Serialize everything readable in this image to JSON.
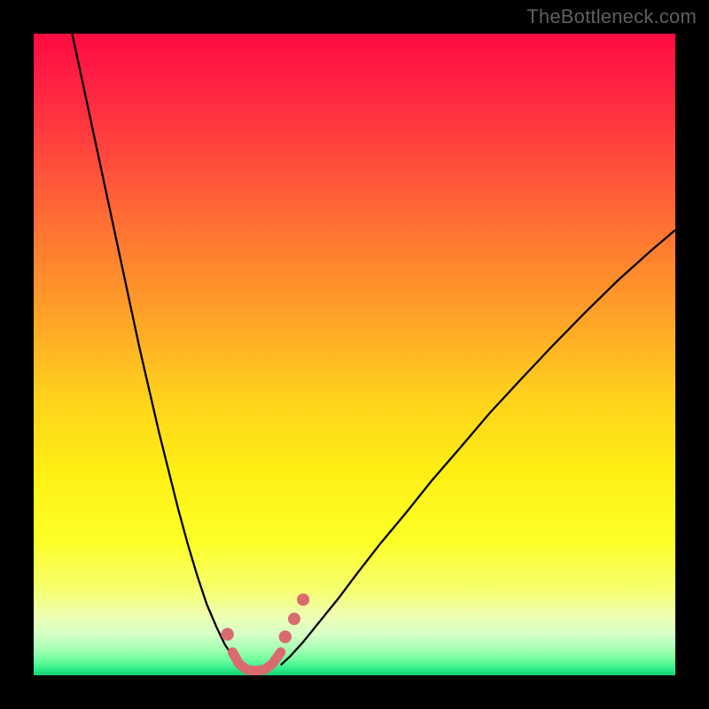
{
  "watermark": {
    "text": "TheBottleneck.com"
  },
  "chart_data": {
    "type": "line",
    "title": "",
    "xlabel": "",
    "ylabel": "",
    "xlim": [
      0,
      100
    ],
    "ylim": [
      0,
      100
    ],
    "grid": false,
    "legend": false,
    "background_gradient_stops": [
      {
        "offset": 0.0,
        "color": "#ff0b41"
      },
      {
        "offset": 0.07,
        "color": "#ff1f42"
      },
      {
        "offset": 0.15,
        "color": "#ff3a3f"
      },
      {
        "offset": 0.28,
        "color": "#ff6a35"
      },
      {
        "offset": 0.42,
        "color": "#ff9b29"
      },
      {
        "offset": 0.56,
        "color": "#ffcf1d"
      },
      {
        "offset": 0.68,
        "color": "#feef14"
      },
      {
        "offset": 0.79,
        "color": "#fdff26"
      },
      {
        "offset": 0.87,
        "color": "#f6ff73"
      },
      {
        "offset": 0.905,
        "color": "#efffb0"
      },
      {
        "offset": 0.935,
        "color": "#d7ffc7"
      },
      {
        "offset": 0.958,
        "color": "#a8ffb5"
      },
      {
        "offset": 0.975,
        "color": "#73ffa1"
      },
      {
        "offset": 0.992,
        "color": "#28e985"
      },
      {
        "offset": 1.0,
        "color": "#16cf72"
      }
    ],
    "series": [
      {
        "name": "left-curve",
        "stroke": "#000000",
        "stroke_width": 2.3,
        "x": [
          6.0,
          7.5,
          9.0,
          10.5,
          12.0,
          13.5,
          15.0,
          16.5,
          18.0,
          19.5,
          21.0,
          22.5,
          24.0,
          25.5,
          27.0,
          28.5,
          29.8,
          31.0,
          32.5
        ],
        "y": [
          100.0,
          93.0,
          86.0,
          79.0,
          72.0,
          65.0,
          58.0,
          51.0,
          44.5,
          38.0,
          32.0,
          26.0,
          20.5,
          15.5,
          11.0,
          7.5,
          4.8,
          3.0,
          1.6
        ]
      },
      {
        "name": "right-curve",
        "stroke": "#000000",
        "stroke_width": 2.3,
        "x": [
          38.5,
          40.0,
          42.0,
          44.5,
          47.5,
          50.5,
          54.0,
          58.0,
          62.0,
          66.5,
          71.0,
          76.0,
          81.0,
          86.0,
          91.0,
          96.0,
          100.0
        ],
        "y": [
          1.6,
          3.0,
          5.2,
          8.3,
          12.0,
          16.0,
          20.5,
          25.3,
          30.3,
          35.5,
          40.8,
          46.2,
          51.5,
          56.6,
          61.5,
          66.0,
          69.4
        ]
      },
      {
        "name": "valley-highlight",
        "stroke": "#d96a6e",
        "stroke_width": 11,
        "linecap": "round",
        "x": [
          31.0,
          32.0,
          33.2,
          34.5,
          36.0,
          37.2,
          38.5
        ],
        "y": [
          3.6,
          1.8,
          0.9,
          0.7,
          0.9,
          1.8,
          3.6
        ]
      }
    ],
    "markers": [
      {
        "cx": 30.2,
        "cy": 6.4,
        "r": 7.2,
        "fill": "#d96a6e"
      },
      {
        "cx": 39.2,
        "cy": 6.0,
        "r": 7.2,
        "fill": "#d96a6e"
      },
      {
        "cx": 40.6,
        "cy": 8.8,
        "r": 7.0,
        "fill": "#d96a6e"
      },
      {
        "cx": 42.0,
        "cy": 11.8,
        "r": 7.0,
        "fill": "#d96a6e"
      }
    ]
  }
}
